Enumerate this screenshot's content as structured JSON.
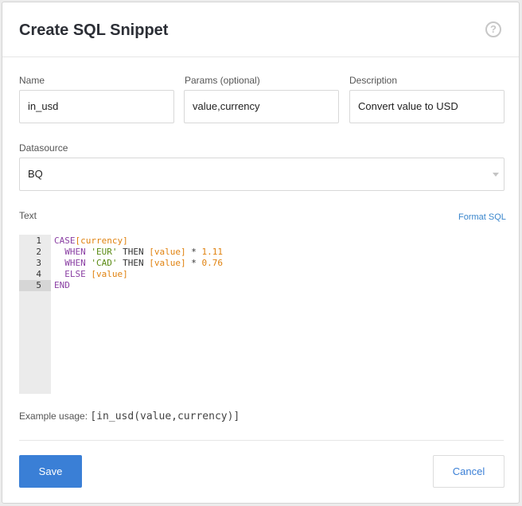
{
  "dialog": {
    "title": "Create SQL Snippet",
    "help_icon": "question-circle-icon",
    "help_glyph": "?"
  },
  "form": {
    "name": {
      "label": "Name",
      "value": "in_usd"
    },
    "params": {
      "label": "Params (optional)",
      "value": "value,currency"
    },
    "description": {
      "label": "Description",
      "value": "Convert value to USD"
    },
    "datasource": {
      "label": "Datasource",
      "value": "BQ"
    },
    "text": {
      "label": "Text",
      "format_link": "Format SQL"
    }
  },
  "editor": {
    "line_numbers": [
      "1",
      "2",
      "3",
      "4",
      "5"
    ],
    "active_line": 5,
    "lines": [
      [
        {
          "t": "kw",
          "v": "CASE"
        },
        {
          "t": "var",
          "v": "[currency]"
        }
      ],
      [
        {
          "t": "op",
          "v": "  "
        },
        {
          "t": "kw",
          "v": "WHEN"
        },
        {
          "t": "op",
          "v": " "
        },
        {
          "t": "str",
          "v": "'EUR'"
        },
        {
          "t": "op",
          "v": " THEN "
        },
        {
          "t": "var",
          "v": "[value]"
        },
        {
          "t": "op",
          "v": " * "
        },
        {
          "t": "num",
          "v": "1.11"
        }
      ],
      [
        {
          "t": "op",
          "v": "  "
        },
        {
          "t": "kw",
          "v": "WHEN"
        },
        {
          "t": "op",
          "v": " "
        },
        {
          "t": "str",
          "v": "'CAD'"
        },
        {
          "t": "op",
          "v": " THEN "
        },
        {
          "t": "var",
          "v": "[value]"
        },
        {
          "t": "op",
          "v": " * "
        },
        {
          "t": "num",
          "v": "0.76"
        }
      ],
      [
        {
          "t": "op",
          "v": "  "
        },
        {
          "t": "kw",
          "v": "ELSE"
        },
        {
          "t": "op",
          "v": " "
        },
        {
          "t": "var",
          "v": "[value]"
        }
      ],
      [
        {
          "t": "kw",
          "v": "END"
        }
      ]
    ]
  },
  "example": {
    "label": "Example usage:",
    "code": "[in_usd(value,currency)]"
  },
  "buttons": {
    "save": "Save",
    "cancel": "Cancel"
  },
  "colors": {
    "primary": "#3a7fd6",
    "keyword": "#8a3fa3",
    "variable": "#e0820f",
    "string": "#5a8a14"
  }
}
